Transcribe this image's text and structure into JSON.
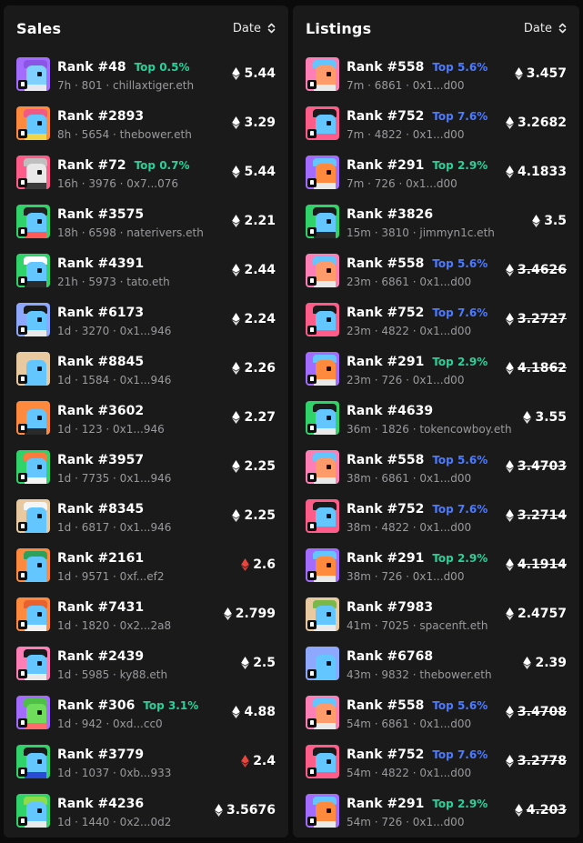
{
  "sales": {
    "title": "Sales",
    "sort_label": "Date",
    "rows": [
      {
        "rank": "Rank #48",
        "top": "Top 0.5%",
        "top_color": "green",
        "meta": "7h · 801 · chillaxtiger.eth",
        "price": "5.44",
        "eth_color": "#ffffff",
        "strike": false,
        "avatar": {
          "bg": "#a36bff",
          "face": "#7fd0ff",
          "hat": "#8c55e6",
          "body": "#e7e7f2"
        }
      },
      {
        "rank": "Rank #2893",
        "top": "",
        "top_color": "",
        "meta": "8h · 5654 · thebower.eth",
        "price": "3.29",
        "eth_color": "#ffffff",
        "strike": false,
        "avatar": {
          "bg": "#ff8a3d",
          "face": "#63c6ff",
          "hat": "#f25a84",
          "body": "#f0d44a"
        }
      },
      {
        "rank": "Rank #72",
        "top": "Top 0.7%",
        "top_color": "green",
        "meta": "16h · 3976 · 0x7...076",
        "price": "5.44",
        "eth_color": "#ffffff",
        "strike": false,
        "avatar": {
          "bg": "#ff5c8a",
          "face": "#e8e8e8",
          "hat": "#bfbfbf",
          "body": "#3a3a3a"
        }
      },
      {
        "rank": "Rank #3575",
        "top": "",
        "top_color": "",
        "meta": "18h · 6598 · naterivers.eth",
        "price": "2.21",
        "eth_color": "#ffffff",
        "strike": false,
        "avatar": {
          "bg": "#2fd36a",
          "face": "#63c6ff",
          "hat": "#222222",
          "body": "#ff5a5a"
        }
      },
      {
        "rank": "Rank #4391",
        "top": "",
        "top_color": "",
        "meta": "21h · 5973 · tato.eth",
        "price": "2.44",
        "eth_color": "#ffffff",
        "strike": false,
        "avatar": {
          "bg": "#2fd36a",
          "face": "#63c6ff",
          "hat": "#ffffff",
          "body": "#2a2a2a"
        }
      },
      {
        "rank": "Rank #6173",
        "top": "",
        "top_color": "",
        "meta": "1d · 3270 · 0x1...946",
        "price": "2.24",
        "eth_color": "#ffffff",
        "strike": false,
        "avatar": {
          "bg": "#8fa8ff",
          "face": "#63c6ff",
          "hat": "#1b1b1b",
          "body": "#e9e9e9"
        }
      },
      {
        "rank": "Rank #8845",
        "top": "",
        "top_color": "",
        "meta": "1d · 1584 · 0x1...946",
        "price": "2.26",
        "eth_color": "#ffffff",
        "strike": false,
        "avatar": {
          "bg": "#e8c9a0",
          "face": "#63c6ff",
          "hat": "#e8c9a0",
          "body": "#63c6ff"
        }
      },
      {
        "rank": "Rank #3602",
        "top": "",
        "top_color": "",
        "meta": "1d · 123 · 0x1...946",
        "price": "2.27",
        "eth_color": "#ffffff",
        "strike": false,
        "avatar": {
          "bg": "#ff8a3d",
          "face": "#63c6ff",
          "hat": "#ff8a3d",
          "body": "#2a2a2a"
        }
      },
      {
        "rank": "Rank #3957",
        "top": "",
        "top_color": "",
        "meta": "1d · 7735 · 0x1...946",
        "price": "2.25",
        "eth_color": "#ffffff",
        "strike": false,
        "avatar": {
          "bg": "#2fd36a",
          "face": "#63c6ff",
          "hat": "#ff7a3d",
          "body": "#f4f4f4"
        }
      },
      {
        "rank": "Rank #8345",
        "top": "",
        "top_color": "",
        "meta": "1d · 6817 · 0x1...946",
        "price": "2.25",
        "eth_color": "#ffffff",
        "strike": false,
        "avatar": {
          "bg": "#e8c9a0",
          "face": "#63c6ff",
          "hat": "#f5f5f5",
          "body": "#63c6ff"
        }
      },
      {
        "rank": "Rank #2161",
        "top": "",
        "top_color": "",
        "meta": "1d · 9571 · 0xf...ef2",
        "price": "2.6",
        "eth_color": "#e8453c",
        "strike": false,
        "avatar": {
          "bg": "#ff8a3d",
          "face": "#63c6ff",
          "hat": "#2fa05a",
          "body": "#63c6ff"
        }
      },
      {
        "rank": "Rank #7431",
        "top": "",
        "top_color": "",
        "meta": "1d · 1820 · 0x2...2a8",
        "price": "2.799",
        "eth_color": "#ffffff",
        "strike": false,
        "avatar": {
          "bg": "#ff8a3d",
          "face": "#63c6ff",
          "hat": "#e8622f",
          "body": "#f0f0f0"
        }
      },
      {
        "rank": "Rank #2439",
        "top": "",
        "top_color": "",
        "meta": "1d · 5985 · ky88.eth",
        "price": "2.5",
        "eth_color": "#ffffff",
        "strike": false,
        "avatar": {
          "bg": "#ff7eb6",
          "face": "#63c6ff",
          "hat": "#1b1b1b",
          "body": "#e9e9e9"
        }
      },
      {
        "rank": "Rank #306",
        "top": "Top 3.1%",
        "top_color": "green",
        "meta": "1d · 942 · 0xd...cc0",
        "price": "4.88",
        "eth_color": "#ffffff",
        "strike": false,
        "avatar": {
          "bg": "#a36bff",
          "face": "#6fdc5c",
          "hat": "#4fbf48",
          "body": "#ff6b6b"
        }
      },
      {
        "rank": "Rank #3779",
        "top": "",
        "top_color": "",
        "meta": "1d · 1037 · 0xb...933",
        "price": "2.4",
        "eth_color": "#e8453c",
        "strike": false,
        "avatar": {
          "bg": "#2fd36a",
          "face": "#63c6ff",
          "hat": "#1b1b1b",
          "body": "#2a4bd6"
        }
      },
      {
        "rank": "Rank #4236",
        "top": "",
        "top_color": "",
        "meta": "1d · 1440 · 0x2...0d2",
        "price": "3.5676",
        "eth_color": "#ffffff",
        "strike": false,
        "avatar": {
          "bg": "#2fd36a",
          "face": "#63c6ff",
          "hat": "#8fdc4a",
          "body": "#e9e9e9"
        }
      }
    ]
  },
  "listings": {
    "title": "Listings",
    "sort_label": "Date",
    "rows": [
      {
        "rank": "Rank #558",
        "top": "Top 5.6%",
        "top_color": "blue",
        "meta": "7m · 6861 · 0x1...d00",
        "price": "3.457",
        "eth_color": "#ffffff",
        "strike": false,
        "avatar": {
          "bg": "#ff7eb6",
          "face": "#ff9a6b",
          "hat": "#63c6ff",
          "body": "#e9e9e9"
        }
      },
      {
        "rank": "Rank #752",
        "top": "Top 7.6%",
        "top_color": "blue",
        "meta": "7m · 4822 · 0x1...d00",
        "price": "3.2682",
        "eth_color": "#ffffff",
        "strike": false,
        "avatar": {
          "bg": "#ff5c8a",
          "face": "#63c6ff",
          "hat": "#1b1b1b",
          "body": "#ff5c8a"
        }
      },
      {
        "rank": "Rank #291",
        "top": "Top 2.9%",
        "top_color": "green",
        "meta": "7m · 726 · 0x1...d00",
        "price": "4.1833",
        "eth_color": "#ffffff",
        "strike": false,
        "avatar": {
          "bg": "#a36bff",
          "face": "#ff8a3d",
          "hat": "#63c6ff",
          "body": "#e9e9e9"
        }
      },
      {
        "rank": "Rank #3826",
        "top": "",
        "top_color": "",
        "meta": "15m · 3810 · jimmyn1c.eth",
        "price": "3.5",
        "eth_color": "#ffffff",
        "strike": false,
        "avatar": {
          "bg": "#2fd36a",
          "face": "#63c6ff",
          "hat": "#1b1b1b",
          "body": "#2a2a2a"
        }
      },
      {
        "rank": "Rank #558",
        "top": "Top 5.6%",
        "top_color": "blue",
        "meta": "23m · 6861 · 0x1...d00",
        "price": "3.4626",
        "eth_color": "#ffffff",
        "strike": true,
        "avatar": {
          "bg": "#ff7eb6",
          "face": "#ff9a6b",
          "hat": "#63c6ff",
          "body": "#e9e9e9"
        }
      },
      {
        "rank": "Rank #752",
        "top": "Top 7.6%",
        "top_color": "blue",
        "meta": "23m · 4822 · 0x1...d00",
        "price": "3.2727",
        "eth_color": "#ffffff",
        "strike": true,
        "avatar": {
          "bg": "#ff5c8a",
          "face": "#63c6ff",
          "hat": "#1b1b1b",
          "body": "#ff5c8a"
        }
      },
      {
        "rank": "Rank #291",
        "top": "Top 2.9%",
        "top_color": "green",
        "meta": "23m · 726 · 0x1...d00",
        "price": "4.1862",
        "eth_color": "#ffffff",
        "strike": true,
        "avatar": {
          "bg": "#a36bff",
          "face": "#ff8a3d",
          "hat": "#63c6ff",
          "body": "#e9e9e9"
        }
      },
      {
        "rank": "Rank #4639",
        "top": "",
        "top_color": "",
        "meta": "36m · 1826 · tokencowboy.eth",
        "price": "3.55",
        "eth_color": "#ffffff",
        "strike": false,
        "avatar": {
          "bg": "#2fd36a",
          "face": "#63c6ff",
          "hat": "#1b1b1b",
          "body": "#e9e9e9"
        }
      },
      {
        "rank": "Rank #558",
        "top": "Top 5.6%",
        "top_color": "blue",
        "meta": "38m · 6861 · 0x1...d00",
        "price": "3.4703",
        "eth_color": "#ffffff",
        "strike": true,
        "avatar": {
          "bg": "#ff7eb6",
          "face": "#ff9a6b",
          "hat": "#63c6ff",
          "body": "#e9e9e9"
        }
      },
      {
        "rank": "Rank #752",
        "top": "Top 7.6%",
        "top_color": "blue",
        "meta": "38m · 4822 · 0x1...d00",
        "price": "3.2714",
        "eth_color": "#ffffff",
        "strike": true,
        "avatar": {
          "bg": "#ff5c8a",
          "face": "#63c6ff",
          "hat": "#1b1b1b",
          "body": "#ff5c8a"
        }
      },
      {
        "rank": "Rank #291",
        "top": "Top 2.9%",
        "top_color": "green",
        "meta": "38m · 726 · 0x1...d00",
        "price": "4.1914",
        "eth_color": "#ffffff",
        "strike": true,
        "avatar": {
          "bg": "#a36bff",
          "face": "#ff8a3d",
          "hat": "#63c6ff",
          "body": "#e9e9e9"
        }
      },
      {
        "rank": "Rank #7983",
        "top": "",
        "top_color": "",
        "meta": "41m · 7025 · spacenft.eth",
        "price": "2.4757",
        "eth_color": "#ffffff",
        "strike": false,
        "avatar": {
          "bg": "#e8c9a0",
          "face": "#63c6ff",
          "hat": "#7ab84a",
          "body": "#e9e9e9"
        }
      },
      {
        "rank": "Rank #6768",
        "top": "",
        "top_color": "",
        "meta": "43m · 9832 · thebower.eth",
        "price": "2.39",
        "eth_color": "#ffffff",
        "strike": false,
        "avatar": {
          "bg": "#8fa8ff",
          "face": "#63c6ff",
          "hat": "#8fa8ff",
          "body": "#63c6ff"
        }
      },
      {
        "rank": "Rank #558",
        "top": "Top 5.6%",
        "top_color": "blue",
        "meta": "54m · 6861 · 0x1...d00",
        "price": "3.4708",
        "eth_color": "#ffffff",
        "strike": true,
        "avatar": {
          "bg": "#ff7eb6",
          "face": "#ff9a6b",
          "hat": "#63c6ff",
          "body": "#e9e9e9"
        }
      },
      {
        "rank": "Rank #752",
        "top": "Top 7.6%",
        "top_color": "blue",
        "meta": "54m · 4822 · 0x1...d00",
        "price": "3.2778",
        "eth_color": "#ffffff",
        "strike": true,
        "avatar": {
          "bg": "#ff5c8a",
          "face": "#63c6ff",
          "hat": "#1b1b1b",
          "body": "#ff5c8a"
        }
      },
      {
        "rank": "Rank #291",
        "top": "Top 2.9%",
        "top_color": "green",
        "meta": "54m · 726 · 0x1...d00",
        "price": "4.203",
        "eth_color": "#ffffff",
        "strike": true,
        "avatar": {
          "bg": "#a36bff",
          "face": "#ff8a3d",
          "hat": "#63c6ff",
          "body": "#e9e9e9"
        }
      }
    ]
  },
  "icons": {
    "sort": "sort-chevrons-icon",
    "currency": "eth-icon",
    "avatar_badge": "platform-badge-icon"
  }
}
